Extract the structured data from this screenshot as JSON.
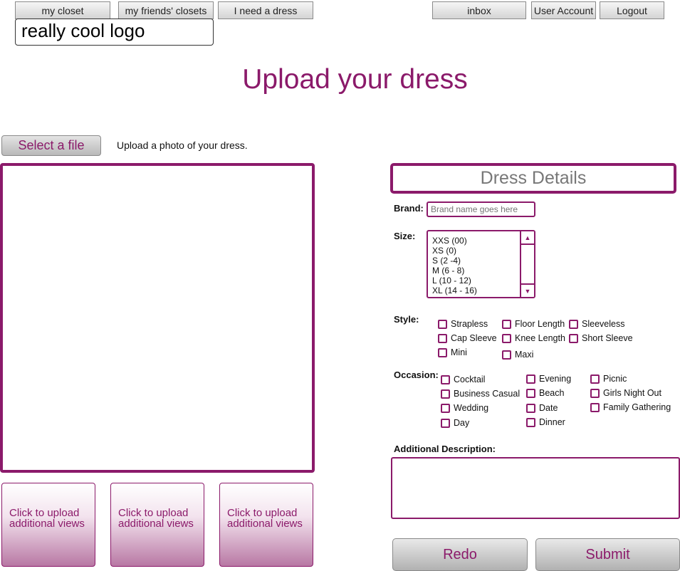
{
  "nav": {
    "my_closet": "my closet",
    "friends_closets": "my friends' closets",
    "need_dress": "I need a dress",
    "inbox": "inbox",
    "user_account": "User Account",
    "logout": "Logout"
  },
  "logo": "really cool logo",
  "page_title": "Upload your dress",
  "upload": {
    "select_file": "Select a file",
    "hint": "Upload a photo of your dress.",
    "thumb_label_1": "Click to upload additional views",
    "thumb_label_2": "Click to upload additional views",
    "thumb_label_3": "Click to upload additional views"
  },
  "details": {
    "header": "Dress Details",
    "brand_label": "Brand:",
    "brand_placeholder": "Brand name goes here",
    "size_label": "Size:",
    "sizes": [
      "XXS (00)",
      "XS (0)",
      "S (2 -4)",
      "M (6 - 8)",
      "L (10 - 12)",
      "XL (14 - 16)"
    ],
    "style_label": "Style:",
    "styles": [
      "Strapless",
      "Floor Length",
      "Sleeveless",
      "Cap Sleeve",
      "Knee Length",
      "Short Sleeve",
      "Mini",
      "Maxi"
    ],
    "occasion_label": "Occasion:",
    "occasions": [
      "Cocktail",
      "Evening",
      "Picnic",
      "Business Casual",
      "Beach",
      "Girls Night Out",
      "Wedding",
      "Date",
      "Family Gathering",
      "Day",
      "Dinner"
    ],
    "description_label": "Additional Description:"
  },
  "actions": {
    "redo": "Redo",
    "submit": "Submit"
  },
  "colors": {
    "accent": "#8b1a6a"
  }
}
